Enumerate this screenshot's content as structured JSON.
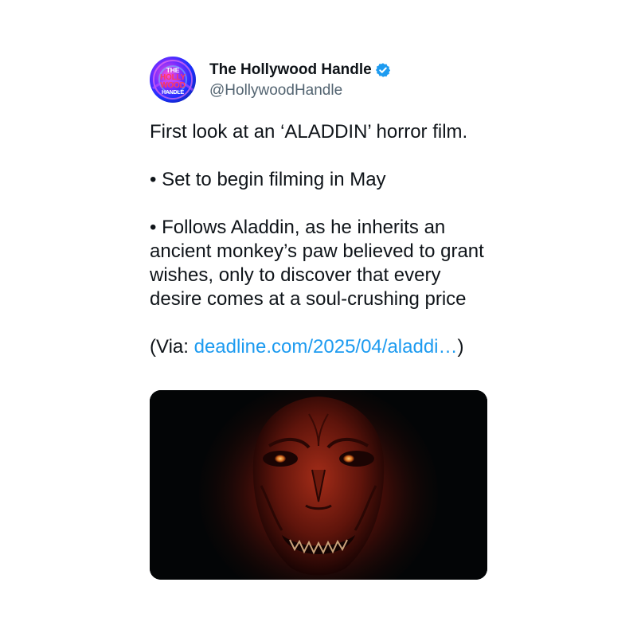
{
  "tweet": {
    "avatar": {
      "line1": "THE",
      "line2": "HOLLY",
      "line3": "WOOD",
      "line4": "HANDLE"
    },
    "display_name": "The Hollywood Handle",
    "verified_icon": "verified-badge-icon",
    "handle": "@HollywoodHandle",
    "text": {
      "line1": "First look at an ‘ALADDIN’ horror film.",
      "bullet1": "• Set to begin filming in May",
      "bullet2": "• Follows Aladdin, as he inherits an ancient monkey’s paw believed to grant wishes, only to discover that every desire comes at a soul-crushing price",
      "via_prefix": "(Via: ",
      "via_link": "deadline.com/2025/04/aladdi…",
      "via_suffix": ")"
    }
  },
  "colors": {
    "text": "#0f1419",
    "handle": "#536471",
    "link": "#1d9bf0",
    "verified": "#1d9bf0"
  }
}
